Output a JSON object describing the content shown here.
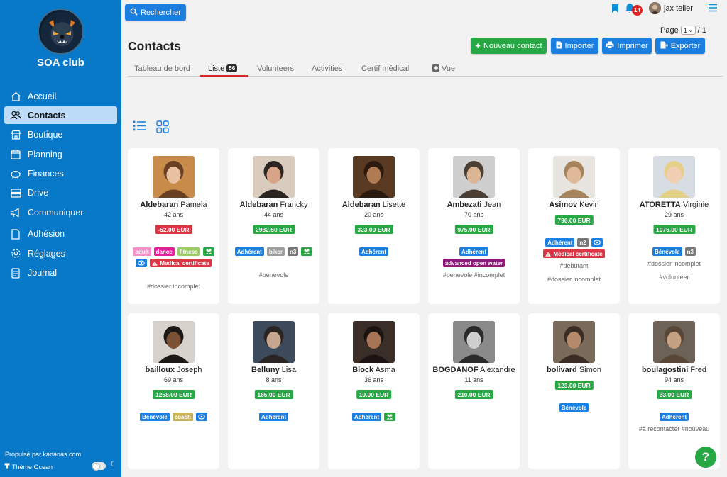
{
  "sidebar": {
    "club_name": "SOA club",
    "items": [
      {
        "label": "Accueil",
        "icon": "home-icon"
      },
      {
        "label": "Contacts",
        "icon": "users-icon",
        "active": true
      },
      {
        "label": "Boutique",
        "icon": "shop-icon"
      },
      {
        "label": "Planning",
        "icon": "calendar-icon"
      },
      {
        "label": "Finances",
        "icon": "piggy-bank-icon"
      },
      {
        "label": "Drive",
        "icon": "drive-icon"
      },
      {
        "label": "Communiquer",
        "icon": "megaphone-icon"
      },
      {
        "label": "Adhésion",
        "icon": "document-icon"
      },
      {
        "label": "Réglages",
        "icon": "gear-icon"
      },
      {
        "label": "Journal",
        "icon": "journal-icon"
      }
    ],
    "powered_by": "Propulsé par kananas.com",
    "theme_label": "Thème Ocean"
  },
  "topbar": {
    "search_label": "Rechercher",
    "notifications_count": "14",
    "user_name": "jax teller"
  },
  "pagination": {
    "label": "Page",
    "current": "1",
    "total": "/ 1"
  },
  "header": {
    "title": "Contacts",
    "buttons": {
      "new_contact": "Nouveau contact",
      "import": "Importer",
      "print": "Imprimer",
      "export": "Exporter"
    }
  },
  "tabs": [
    {
      "label": "Tableau de bord"
    },
    {
      "label": "Liste",
      "count": "56",
      "active": true
    },
    {
      "label": "Volunteers"
    },
    {
      "label": "Activities"
    },
    {
      "label": "Certif médical"
    },
    {
      "label": "Vue"
    }
  ],
  "colors": {
    "sidebar": "#0879c8",
    "primary": "#1a7fe0",
    "success": "#28a745",
    "danger": "#dc3545",
    "tab_active": "#d6242b"
  },
  "contacts": [
    {
      "last": "Aldebaran",
      "first": "Pamela",
      "age": "42 ans",
      "balance": "-52.00 EUR",
      "balance_status": "negative",
      "tags": [
        {
          "text": "adult",
          "color": "#f48fc8"
        },
        {
          "text": "dance",
          "color": "#e91e9b"
        },
        {
          "text": "fitness",
          "color": "#9ccc65"
        },
        {
          "icon": "group-icon",
          "color": "#28a745"
        },
        {
          "icon": "eye-icon",
          "color": "#1a7fe0"
        },
        {
          "text": "Medical certificate",
          "icon": "warning-icon",
          "color": "#dc3545"
        }
      ],
      "hashtags": "#dossier incomplet"
    },
    {
      "last": "Aldebaran",
      "first": "Francky",
      "age": "44 ans",
      "balance": "2982.50 EUR",
      "balance_status": "positive",
      "tags": [
        {
          "text": "Adhérent",
          "color": "#1a7fe0"
        },
        {
          "text": "biker",
          "color": "#9e9e9e"
        },
        {
          "text": "n3",
          "color": "#777"
        },
        {
          "icon": "group-icon",
          "color": "#28a745"
        }
      ],
      "hashtags": "#benevole"
    },
    {
      "last": "Aldebaran",
      "first": "Lisette",
      "age": "20 ans",
      "balance": "323.00 EUR",
      "balance_status": "positive",
      "tags": [
        {
          "text": "Adhérent",
          "color": "#1a7fe0"
        }
      ],
      "hashtags": ""
    },
    {
      "last": "Ambezati",
      "first": "Jean",
      "age": "70 ans",
      "balance": "975.00 EUR",
      "balance_status": "positive",
      "tags": [
        {
          "text": "Adhérent",
          "color": "#1a7fe0"
        },
        {
          "text": "advanced open water",
          "color": "#8e1a7a"
        }
      ],
      "hashtags": "#benevole  #incomplet"
    },
    {
      "last": "Asimov",
      "first": "Kevin",
      "age": "",
      "balance": "796.00 EUR",
      "balance_status": "positive",
      "tags": [
        {
          "text": "Adhérent",
          "color": "#1a7fe0"
        },
        {
          "text": "n2",
          "color": "#777"
        },
        {
          "icon": "eye-icon",
          "color": "#1a7fe0"
        },
        {
          "text": "Medical certificate",
          "icon": "warning-icon",
          "color": "#dc3545"
        }
      ],
      "hashtags": "#debutant",
      "hashtags2": "#dossier incomplet"
    },
    {
      "last": "ATORETTA",
      "first": "Virginie",
      "age": "29 ans",
      "balance": "1076.00 EUR",
      "balance_status": "positive",
      "tags": [
        {
          "text": "Bénévole",
          "color": "#1a7fe0"
        },
        {
          "text": "n3",
          "color": "#777"
        }
      ],
      "hashtags": "#dossier incomplet",
      "hashtags2": "#volunteer"
    },
    {
      "last": "bailloux",
      "first": "Joseph",
      "age": "69 ans",
      "balance": "1258.00 EUR",
      "balance_status": "positive",
      "tags": [
        {
          "text": "Bénévole",
          "color": "#1a7fe0"
        },
        {
          "text": "coach",
          "color": "#c9b458"
        },
        {
          "icon": "eye-icon",
          "color": "#1a7fe0"
        }
      ],
      "hashtags": ""
    },
    {
      "last": "Belluny",
      "first": "Lisa",
      "age": "8 ans",
      "balance": "165.00 EUR",
      "balance_status": "positive",
      "tags": [
        {
          "text": "Adhérent",
          "color": "#1a7fe0"
        }
      ],
      "hashtags": ""
    },
    {
      "last": "Block",
      "first": "Asma",
      "age": "36 ans",
      "balance": "10.00 EUR",
      "balance_status": "positive",
      "tags": [
        {
          "text": "Adhérent",
          "color": "#1a7fe0"
        },
        {
          "icon": "group-icon",
          "color": "#28a745"
        }
      ],
      "hashtags": ""
    },
    {
      "last": "BOGDANOF",
      "first": "Alexandre",
      "age": "11 ans",
      "balance": "210.00 EUR",
      "balance_status": "positive",
      "tags": [],
      "hashtags": ""
    },
    {
      "last": "bolivard",
      "first": "Simon",
      "age": "",
      "balance": "123.00 EUR",
      "balance_status": "positive",
      "tags": [
        {
          "text": "Bénévole",
          "color": "#1a7fe0"
        }
      ],
      "hashtags": ""
    },
    {
      "last": "boulagostini",
      "first": "Fred",
      "age": "94 ans",
      "balance": "33.00 EUR",
      "balance_status": "positive",
      "tags": [
        {
          "text": "Adhérent",
          "color": "#1a7fe0"
        }
      ],
      "hashtags": "#a recontacter  #nouveau"
    }
  ]
}
